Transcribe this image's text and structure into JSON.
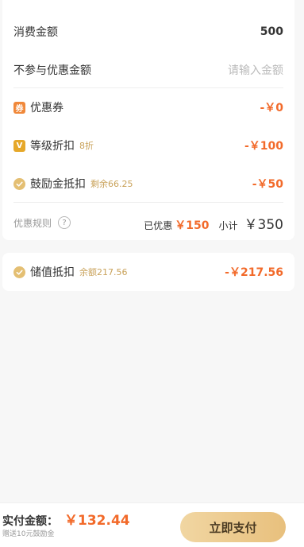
{
  "order": {
    "spend_label": "消费金额",
    "spend_value": "500",
    "exempt_label": "不参与优惠金额",
    "exempt_placeholder": "请输入金额"
  },
  "discounts": {
    "coupon": {
      "icon_text": "券",
      "label": "优惠券",
      "amount": "-￥0"
    },
    "level": {
      "icon_text": "V",
      "label": "等级折扣",
      "note": "8折",
      "amount": "-￥100"
    },
    "reward": {
      "label": "鼓励金抵扣",
      "note": "剩余66.25",
      "amount": "-￥50"
    }
  },
  "rules": {
    "label": "优惠规则",
    "help_symbol": "?",
    "discount_label": "已优惠",
    "discount_amount": "￥150",
    "subtotal_label": "小计",
    "subtotal_amount": "￥350"
  },
  "wallet": {
    "label": "储值抵扣",
    "note": "余额217.56",
    "amount": "-￥217.56"
  },
  "footer": {
    "pay_label": "实付金额：",
    "pay_amount": "￥132.44",
    "gift_note": "赠送10元鼓励金",
    "pay_button": "立即支付"
  },
  "colors": {
    "accent_red": "#f26a2a",
    "gold": "#c9a25a",
    "button_gold": "#e8c07d"
  }
}
